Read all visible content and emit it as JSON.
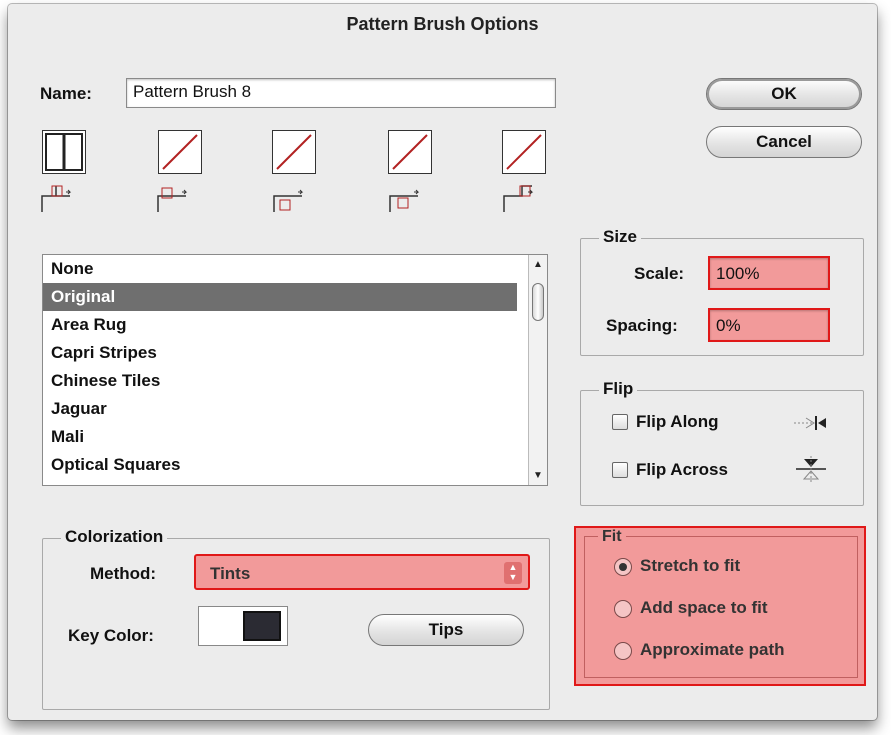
{
  "dialog": {
    "title": "Pattern Brush Options"
  },
  "name": {
    "label": "Name:",
    "value": "Pattern Brush 8"
  },
  "buttons": {
    "ok": "OK",
    "cancel": "Cancel",
    "tips": "Tips"
  },
  "pattern_list": {
    "items": [
      "None",
      "Original",
      "Area Rug",
      "Capri Stripes",
      "Chinese Tiles",
      "Jaguar",
      "Mali",
      "Optical Squares"
    ],
    "selected": "Original"
  },
  "size": {
    "legend": "Size",
    "scale_label": "Scale:",
    "scale_value": "100%",
    "spacing_label": "Spacing:",
    "spacing_value": "0%"
  },
  "flip": {
    "legend": "Flip",
    "along_label": "Flip Along",
    "across_label": "Flip Across"
  },
  "colorization": {
    "legend": "Colorization",
    "method_label": "Method:",
    "method_value": "Tints",
    "key_color_label": "Key Color:"
  },
  "fit": {
    "legend": "Fit",
    "options": [
      "Stretch to fit",
      "Add space to fit",
      "Approximate path"
    ],
    "selected": "Stretch to fit"
  },
  "colors": {
    "highlight_fill": "#f29a9a",
    "highlight_border": "#e01818",
    "selection": "#6f6f6f",
    "tile_line": "#b22222"
  }
}
